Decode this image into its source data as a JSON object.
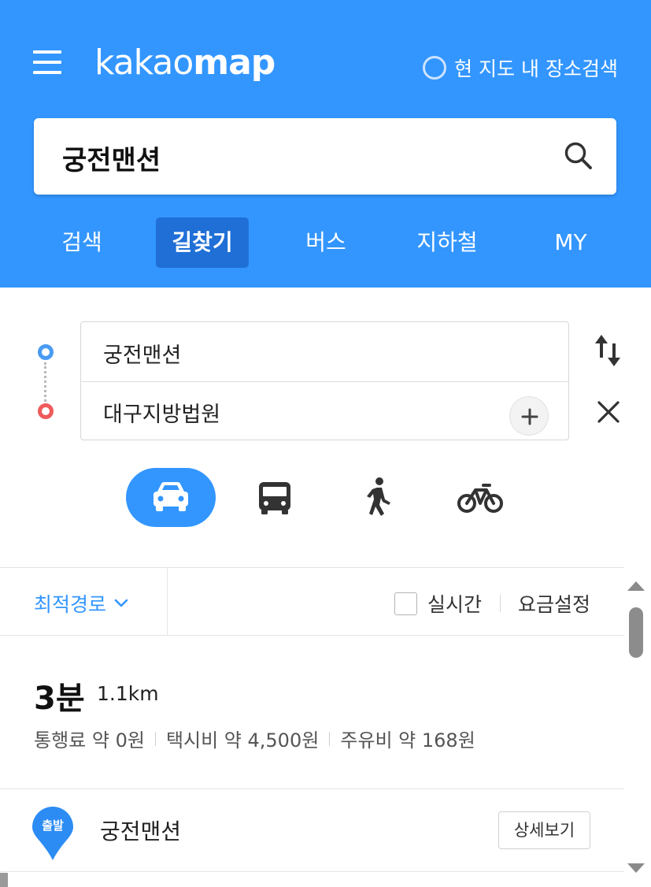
{
  "header": {
    "logo_thin": "kakao",
    "logo_bold": "map",
    "map_search_label": "현 지도 내 장소검색",
    "search_query": "궁전맨션",
    "tabs": [
      {
        "label": "검색"
      },
      {
        "label": "길찾기"
      },
      {
        "label": "버스"
      },
      {
        "label": "지하철"
      },
      {
        "label": "MY"
      }
    ],
    "active_tab": "길찾기"
  },
  "route": {
    "origin": "궁전맨션",
    "destination": "대구지방법원",
    "modes": [
      "car-icon",
      "bus-icon",
      "walk-icon",
      "bike-icon"
    ],
    "active_mode": "car"
  },
  "options": {
    "route_type": "최적경로",
    "realtime_label": "실시간",
    "realtime_checked": false,
    "fare_setting": "요금설정"
  },
  "summary": {
    "time": "3분",
    "distance": "1.1km",
    "toll": "통행료 약 0원",
    "taxi": "택시비 약 4,500원",
    "fuel": "주유비 약 168원"
  },
  "steps": [
    {
      "badge": "출발",
      "place": "궁전맨션",
      "detail_label": "상세보기"
    }
  ],
  "colors": {
    "brand": "#3396ff",
    "active_tab": "#1f6fd7",
    "origin_dot": "#4a9cf3",
    "destination_dot": "#ef5b5b"
  }
}
